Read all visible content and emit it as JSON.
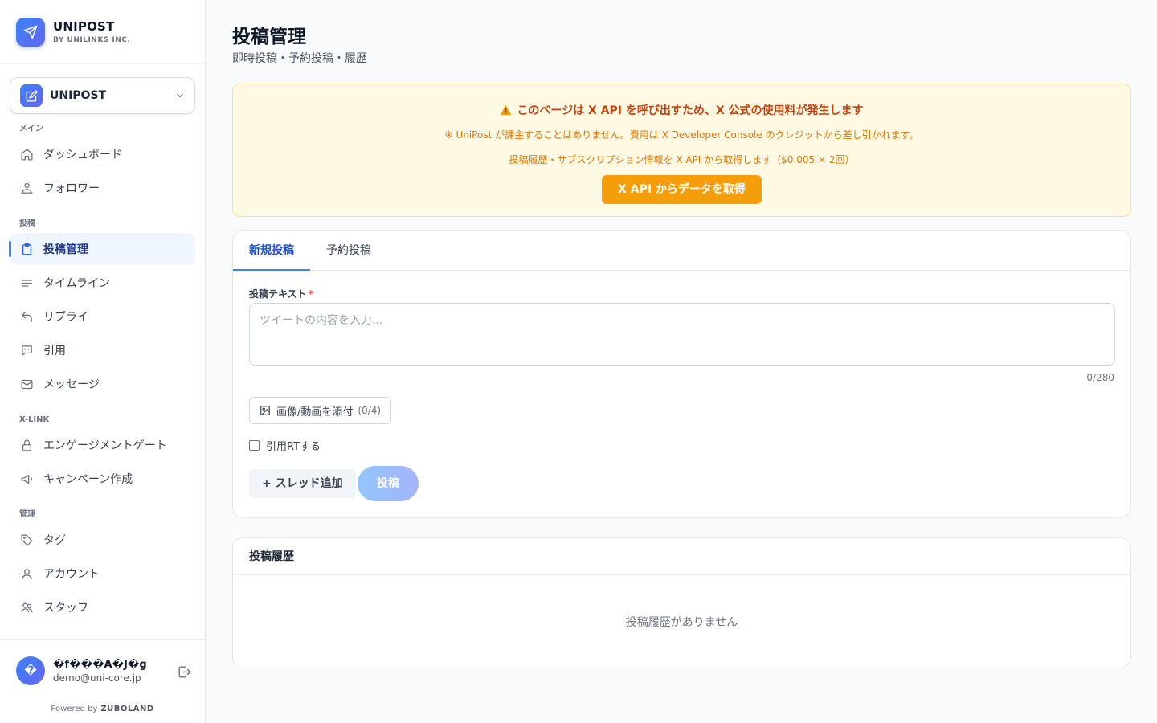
{
  "brand": {
    "title": "UNIPOST",
    "subtitle": "BY UNILINKS INC."
  },
  "account_selector": {
    "name": "UNIPOST"
  },
  "nav": {
    "sections": [
      {
        "label": "メイン",
        "items": [
          {
            "label": "ダッシュボード",
            "icon": "home-icon"
          },
          {
            "label": "フォロワー",
            "icon": "followers-icon"
          }
        ]
      },
      {
        "label": "投稿",
        "items": [
          {
            "label": "投稿管理",
            "icon": "clipboard-icon",
            "active": true
          },
          {
            "label": "タイムライン",
            "icon": "lines-icon"
          },
          {
            "label": "リプライ",
            "icon": "reply-icon"
          },
          {
            "label": "引用",
            "icon": "comment-icon"
          },
          {
            "label": "メッセージ",
            "icon": "mail-icon"
          }
        ]
      },
      {
        "label": "X-LINK",
        "items": [
          {
            "label": "エンゲージメントゲート",
            "icon": "lock-icon"
          },
          {
            "label": "キャンペーン作成",
            "icon": "megaphone-icon"
          }
        ]
      },
      {
        "label": "管理",
        "items": [
          {
            "label": "タグ",
            "icon": "tag-icon"
          },
          {
            "label": "アカウント",
            "icon": "user-icon"
          },
          {
            "label": "スタッフ",
            "icon": "users-icon"
          }
        ]
      }
    ]
  },
  "user": {
    "avatar": "�",
    "name": "�f���A�J�g",
    "email": "demo@uni-core.jp"
  },
  "powered": {
    "prefix": "Powered by",
    "name": "ZUBOLAND"
  },
  "page": {
    "title": "投稿管理",
    "subtitle": "即時投稿・予約投稿・履歴"
  },
  "warning": {
    "title": "このページは X API を呼び出すため、X 公式の使用料が発生します",
    "note": "※ UniPost が課金することはありません。費用は X Developer Console のクレジットから差し引かれます。",
    "detail": "投稿履歴・サブスクリプション情報を X API から取得します（$0.005 × 2回）",
    "button": "X API からデータを取得"
  },
  "compose": {
    "tabs": [
      "新規投稿",
      "予約投稿"
    ],
    "active_tab": "新規投稿",
    "text_label": "投稿テキスト",
    "required_mark": "*",
    "text_value": "",
    "text_placeholder": "ツイートの内容を入力...",
    "counter": "0/280",
    "attach_label": "画像/動画を添付",
    "attach_count": "(0/4)",
    "quote_label": "引用RTする",
    "quote_checked": false,
    "thread_button": "+ スレッド追加",
    "post_button": "投稿"
  },
  "history": {
    "title": "投稿履歴",
    "empty": "投稿履歴がありません"
  },
  "colors": {
    "accent": "#3b82f6",
    "warning_bg": "#fef9e3",
    "warning_button": "#f59e0b"
  }
}
